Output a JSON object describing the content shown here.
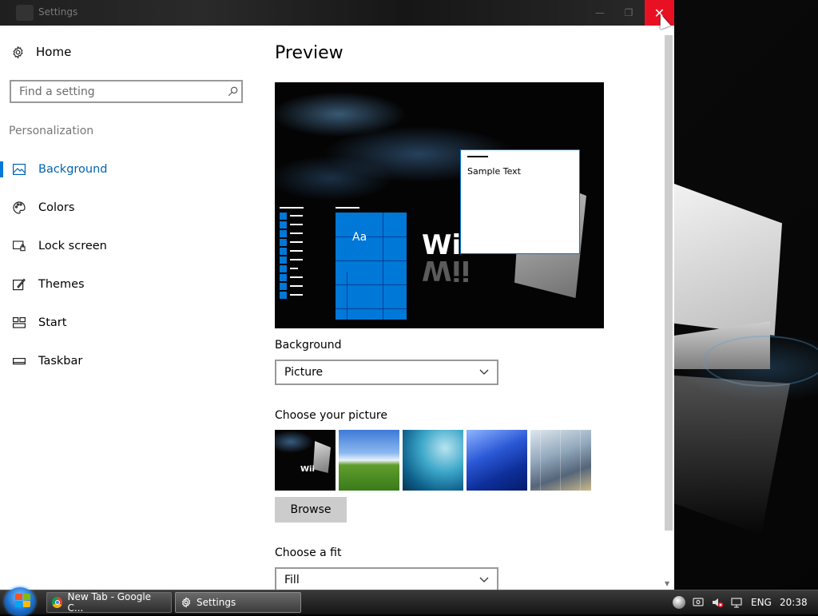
{
  "window": {
    "title": "Settings",
    "minimize_glyph": "—",
    "restore_glyph": "❐",
    "close_glyph": "✕"
  },
  "sidebar": {
    "home_label": "Home",
    "search_placeholder": "Find a setting",
    "section_label": "Personalization",
    "items": [
      {
        "label": "Background",
        "icon": "picture-icon",
        "active": true
      },
      {
        "label": "Colors",
        "icon": "palette-icon"
      },
      {
        "label": "Lock screen",
        "icon": "lock-screen-icon"
      },
      {
        "label": "Themes",
        "icon": "themes-icon"
      },
      {
        "label": "Start",
        "icon": "start-icon"
      },
      {
        "label": "Taskbar",
        "icon": "taskbar-icon"
      }
    ]
  },
  "content": {
    "preview_title": "Preview",
    "preview": {
      "tile_text": "Aa",
      "sample_text": "Sample Text",
      "wallpaper_text": "Wii"
    },
    "background_label": "Background",
    "background_value": "Picture",
    "choose_picture_label": "Choose your picture",
    "thumbnails": [
      {
        "name": "wii-wallpaper",
        "caption": "Wii"
      },
      {
        "name": "bliss-wallpaper"
      },
      {
        "name": "wave-wallpaper"
      },
      {
        "name": "blue-streak-wallpaper"
      },
      {
        "name": "glass-building-wallpaper"
      }
    ],
    "browse_label": "Browse",
    "fit_label": "Choose a fit",
    "fit_value": "Fill"
  },
  "taskbar": {
    "buttons": [
      {
        "label": "New Tab - Google C...",
        "icon": "chrome-icon"
      },
      {
        "label": "Settings",
        "icon": "gear-icon"
      }
    ],
    "language": "ENG",
    "time": "20:38"
  },
  "colors": {
    "accent": "#0078d7",
    "close_red": "#e81123"
  }
}
